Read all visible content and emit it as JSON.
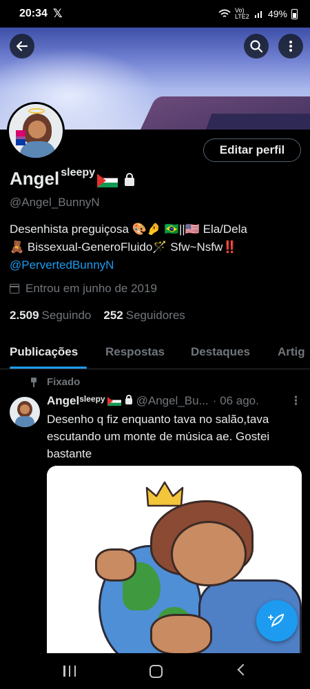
{
  "status_bar": {
    "time": "20:34",
    "x_logo": "𝕏",
    "network": "Vo) LTE2",
    "battery": "49%"
  },
  "header_icons": {
    "back": "back-arrow-icon",
    "search": "search-icon",
    "more": "more-vertical-icon"
  },
  "profile": {
    "name": "Angel",
    "name_sup": "sleepy",
    "handle": "@Angel_BunnyN",
    "edit_label": "Editar perfil",
    "bio_line1": "Desenhista preguiçosa 🎨🤌 🇧🇷||🇺🇸 Ela/Dela",
    "bio_line2": "🧸 Bissexual-GeneroFluido🪄 Sfw~Nsfw‼️",
    "bio_link": "@PervertedBunnyN",
    "joined": "Entrou em junho de 2019",
    "following_count": "2.509",
    "following_label": "Seguindo",
    "followers_count": "252",
    "followers_label": "Seguidores"
  },
  "tabs": [
    {
      "label": "Publicações",
      "active": true
    },
    {
      "label": "Respostas",
      "active": false
    },
    {
      "label": "Destaques",
      "active": false
    },
    {
      "label": "Artig",
      "active": false
    }
  ],
  "pinned_post": {
    "pinned_label": "Fixado",
    "author": "Angel",
    "author_sup": "sleepy",
    "handle": "@Angel_Bu...",
    "date": "· 06 ago.",
    "menu": "⋮",
    "text": "Desenho q fiz enquanto tava no salão,tava escutando um monte de música ae. Gostei bastante"
  },
  "colors": {
    "accent": "#1d9bf0",
    "background": "#000000",
    "text_primary": "#e7e9ea",
    "text_secondary": "#71767b"
  }
}
